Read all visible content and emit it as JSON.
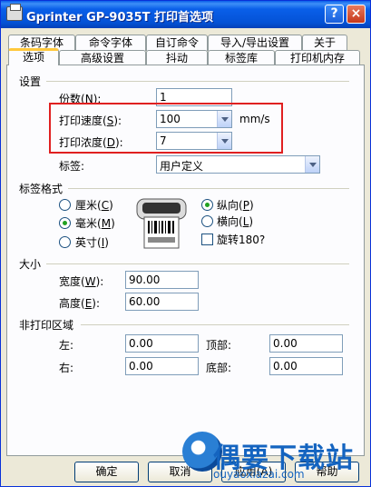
{
  "window": {
    "title": "Gprinter  GP-9035T 打印首选项",
    "help_label": "?",
    "close_label": "×"
  },
  "tabs": {
    "row1": [
      {
        "label": "条码字体"
      },
      {
        "label": "命令字体"
      },
      {
        "label": "自订命令"
      },
      {
        "label": "导入/导出设置"
      },
      {
        "label": "关于"
      }
    ],
    "row2": [
      {
        "label": "选项",
        "active": true
      },
      {
        "label": "高级设置"
      },
      {
        "label": "抖动"
      },
      {
        "label": "标签库"
      },
      {
        "label": "打印机内存"
      }
    ]
  },
  "settings": {
    "group_label": "设置",
    "copies_label": "份数",
    "copies_key": "N",
    "copies_value": "1",
    "speed_label": "打印速度",
    "speed_key": "S",
    "speed_value": "100",
    "speed_unit": "mm/s",
    "density_label": "打印浓度",
    "density_key": "D",
    "density_value": "7",
    "label_label": "标签:",
    "label_value": "用户定义"
  },
  "label_format": {
    "group_label": "标签格式",
    "units": [
      {
        "label": "厘米",
        "key": "C",
        "selected": false
      },
      {
        "label": "毫米",
        "key": "M",
        "selected": true
      },
      {
        "label": "英寸",
        "key": "I",
        "selected": false
      }
    ],
    "orientation": [
      {
        "label": "纵向",
        "key": "P",
        "selected": true
      },
      {
        "label": "横向",
        "key": "L",
        "selected": false
      }
    ],
    "rotate_label": "旋转180?",
    "rotate_checked": false
  },
  "size": {
    "group_label": "大小",
    "width_label": "宽度",
    "width_key": "W",
    "width_value": "90.00",
    "height_label": "高度",
    "height_key": "E",
    "height_value": "60.00"
  },
  "non_print": {
    "group_label": "非打印区域",
    "left_label": "左:",
    "left_value": "0.00",
    "top_label": "顶部:",
    "top_value": "0.00",
    "right_label": "右:",
    "right_value": "0.00",
    "bottom_label": "底部:",
    "bottom_value": "0.00"
  },
  "buttons": {
    "ok": "确定",
    "cancel": "取消",
    "apply": "应用(A)",
    "help": "帮助"
  },
  "watermark": {
    "title": "偶要下载站",
    "url": "ouyaoxiazai.com"
  }
}
